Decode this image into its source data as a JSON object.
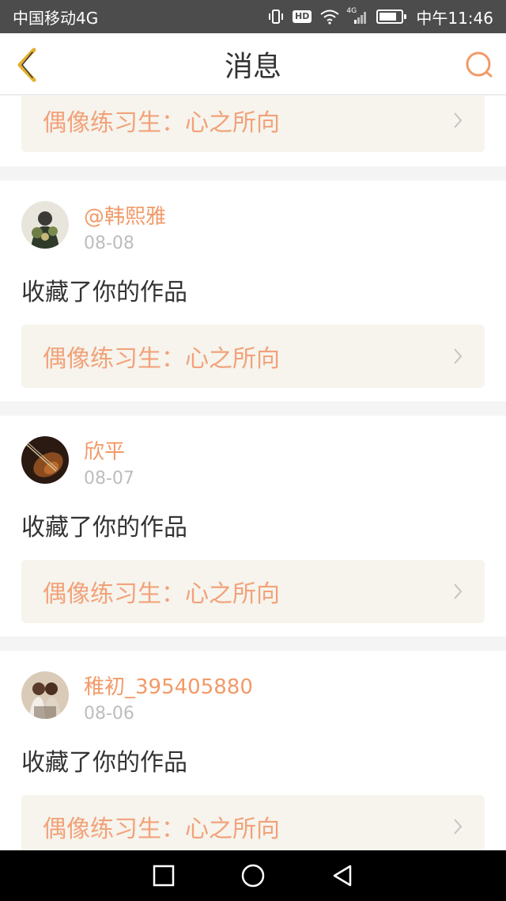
{
  "status_bar": {
    "carrier": "中国移动4G",
    "hd": "HD",
    "network": "4G",
    "time": "中午11:46"
  },
  "header": {
    "title": "消息"
  },
  "partial_item": {
    "work_title": "偶像练习生：心之所向"
  },
  "notifications": [
    {
      "user": "@韩熙雅",
      "date": "08-08",
      "action": "收藏了你的作品",
      "work_title": "偶像练习生：心之所向"
    },
    {
      "user": "欣平",
      "date": "08-07",
      "action": "收藏了你的作品",
      "work_title": "偶像练习生：心之所向"
    },
    {
      "user": "稚初_395405880",
      "date": "08-06",
      "action": "收藏了你的作品",
      "work_title": "偶像练习生：心之所向"
    }
  ],
  "colors": {
    "accent": "#f29a68",
    "link_bg": "#f6f4ed",
    "back_arrow": "#e4b02e"
  },
  "icons": {
    "back": "chevron-left-icon",
    "search": "search-icon",
    "chevron": "chevron-right-icon",
    "nav_recents": "square-icon",
    "nav_home": "circle-icon",
    "nav_back": "triangle-back-icon"
  }
}
